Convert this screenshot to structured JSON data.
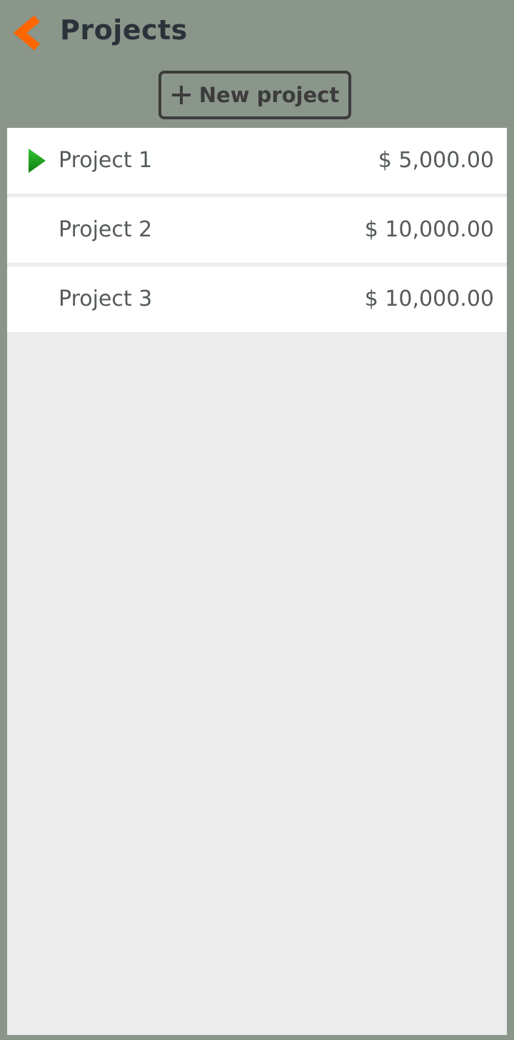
{
  "header": {
    "title": "Projects",
    "back_icon": "chevron-left-icon",
    "accent_color": "#ff6600"
  },
  "toolbar": {
    "new_project_label": "New project",
    "new_project_icon": "plus-icon"
  },
  "projects": [
    {
      "name": "Project 1",
      "amount": "$ 5,000.00",
      "active": true
    },
    {
      "name": "Project 2",
      "amount": "$ 10,000.00",
      "active": false
    },
    {
      "name": "Project 3",
      "amount": "$ 10,000.00",
      "active": false
    }
  ],
  "colors": {
    "background": "#8a968a",
    "list_area": "#ececec",
    "row": "#ffffff",
    "active_indicator": "#1e9a1e"
  }
}
